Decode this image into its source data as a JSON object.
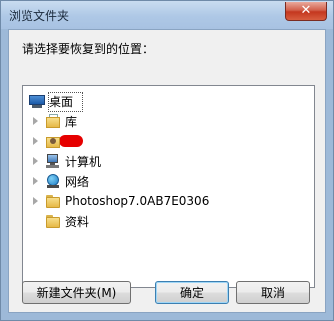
{
  "window": {
    "title": "浏览文件夹",
    "close_glyph": "✕"
  },
  "prompt": "请选择要恢复到的位置：",
  "tree": {
    "items": [
      {
        "label": "桌面",
        "icon": "desktop-icon",
        "selected": true
      },
      {
        "label": "库",
        "icon": "library-folder-icon"
      },
      {
        "label": "",
        "icon": "user-folder-icon",
        "redacted": true
      },
      {
        "label": "计算机",
        "icon": "computer-icon"
      },
      {
        "label": "网络",
        "icon": "network-icon"
      },
      {
        "label": "Photoshop7.0AB7E0306",
        "icon": "folder-icon"
      },
      {
        "label": "资料",
        "icon": "folder-icon"
      }
    ]
  },
  "buttons": {
    "new_folder": "新建文件夹(M)",
    "ok": "确定",
    "cancel": "取消"
  }
}
